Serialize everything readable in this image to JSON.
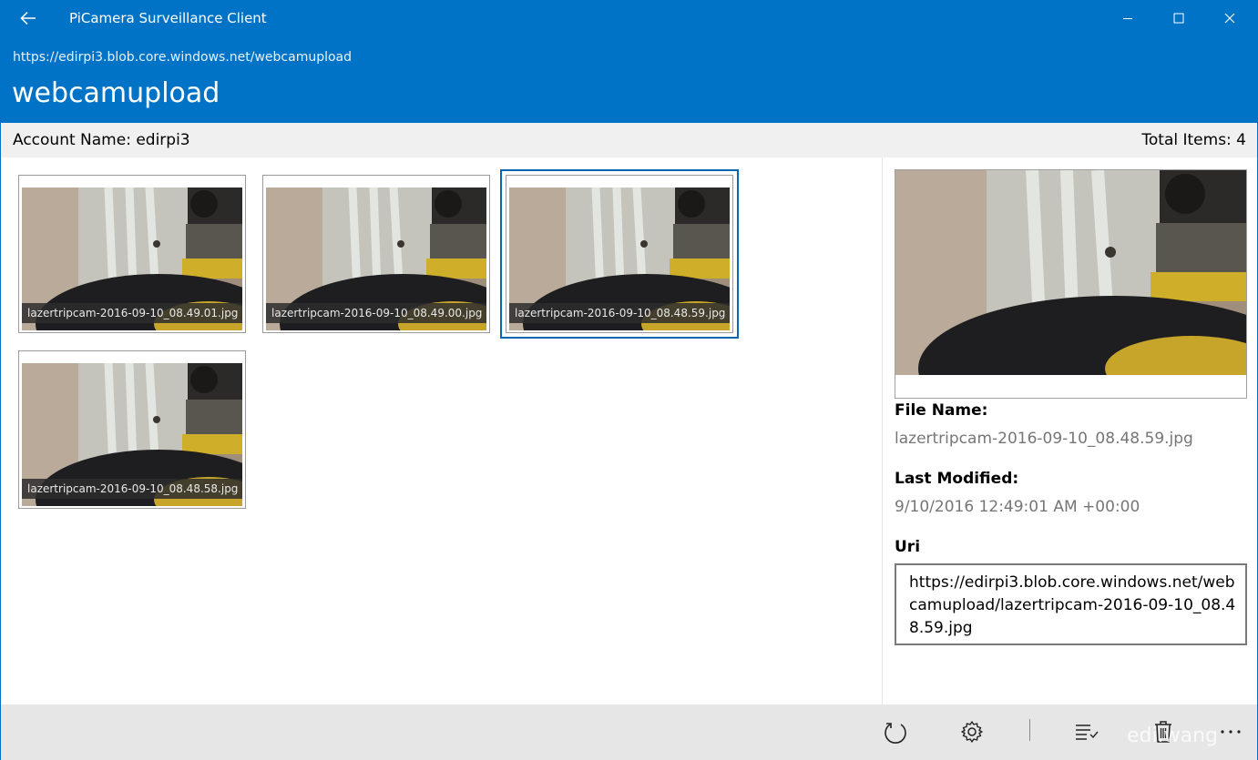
{
  "app": {
    "title": "PiCamera Surveillance Client",
    "container_url": "https://edirpi3.blob.core.windows.net/webcamupload",
    "container_name": "webcamupload"
  },
  "window_controls": [
    "minimize-icon",
    "maximize-icon",
    "close-icon"
  ],
  "infobar": {
    "account_name": "Account Name: edirpi3",
    "total_items": "Total Items: 4"
  },
  "items": [
    {
      "file_name": "lazertripcam-2016-09-10_08.49.01.jpg",
      "selected": false
    },
    {
      "file_name": "lazertripcam-2016-09-10_08.49.00.jpg",
      "selected": false
    },
    {
      "file_name": "lazertripcam-2016-09-10_08.48.59.jpg",
      "selected": true
    },
    {
      "file_name": "lazertripcam-2016-09-10_08.48.58.jpg",
      "selected": false
    }
  ],
  "detail": {
    "file_name_label": "File Name:",
    "file_name": "lazertripcam-2016-09-10_08.48.59.jpg",
    "last_modified_label": "Last Modified:",
    "last_modified": "9/10/2016 12:49:01 AM +00:00",
    "uri_label": "Uri",
    "uri": "https://edirpi3.blob.core.windows.net/webcamupload/lazertripcam-2016-09-10_08.48.59.jpg"
  },
  "commands": [
    {
      "name": "refresh-icon"
    },
    {
      "name": "gear-icon"
    },
    {
      "name": "select-all-icon"
    },
    {
      "name": "delete-icon"
    },
    {
      "name": "more-icon"
    }
  ],
  "watermark": "edi.wang",
  "colors": {
    "accent": "#0173c7",
    "selection": "#0867b4",
    "infobar": "#f0f0f0",
    "cmdbar": "#e6e6e6"
  }
}
